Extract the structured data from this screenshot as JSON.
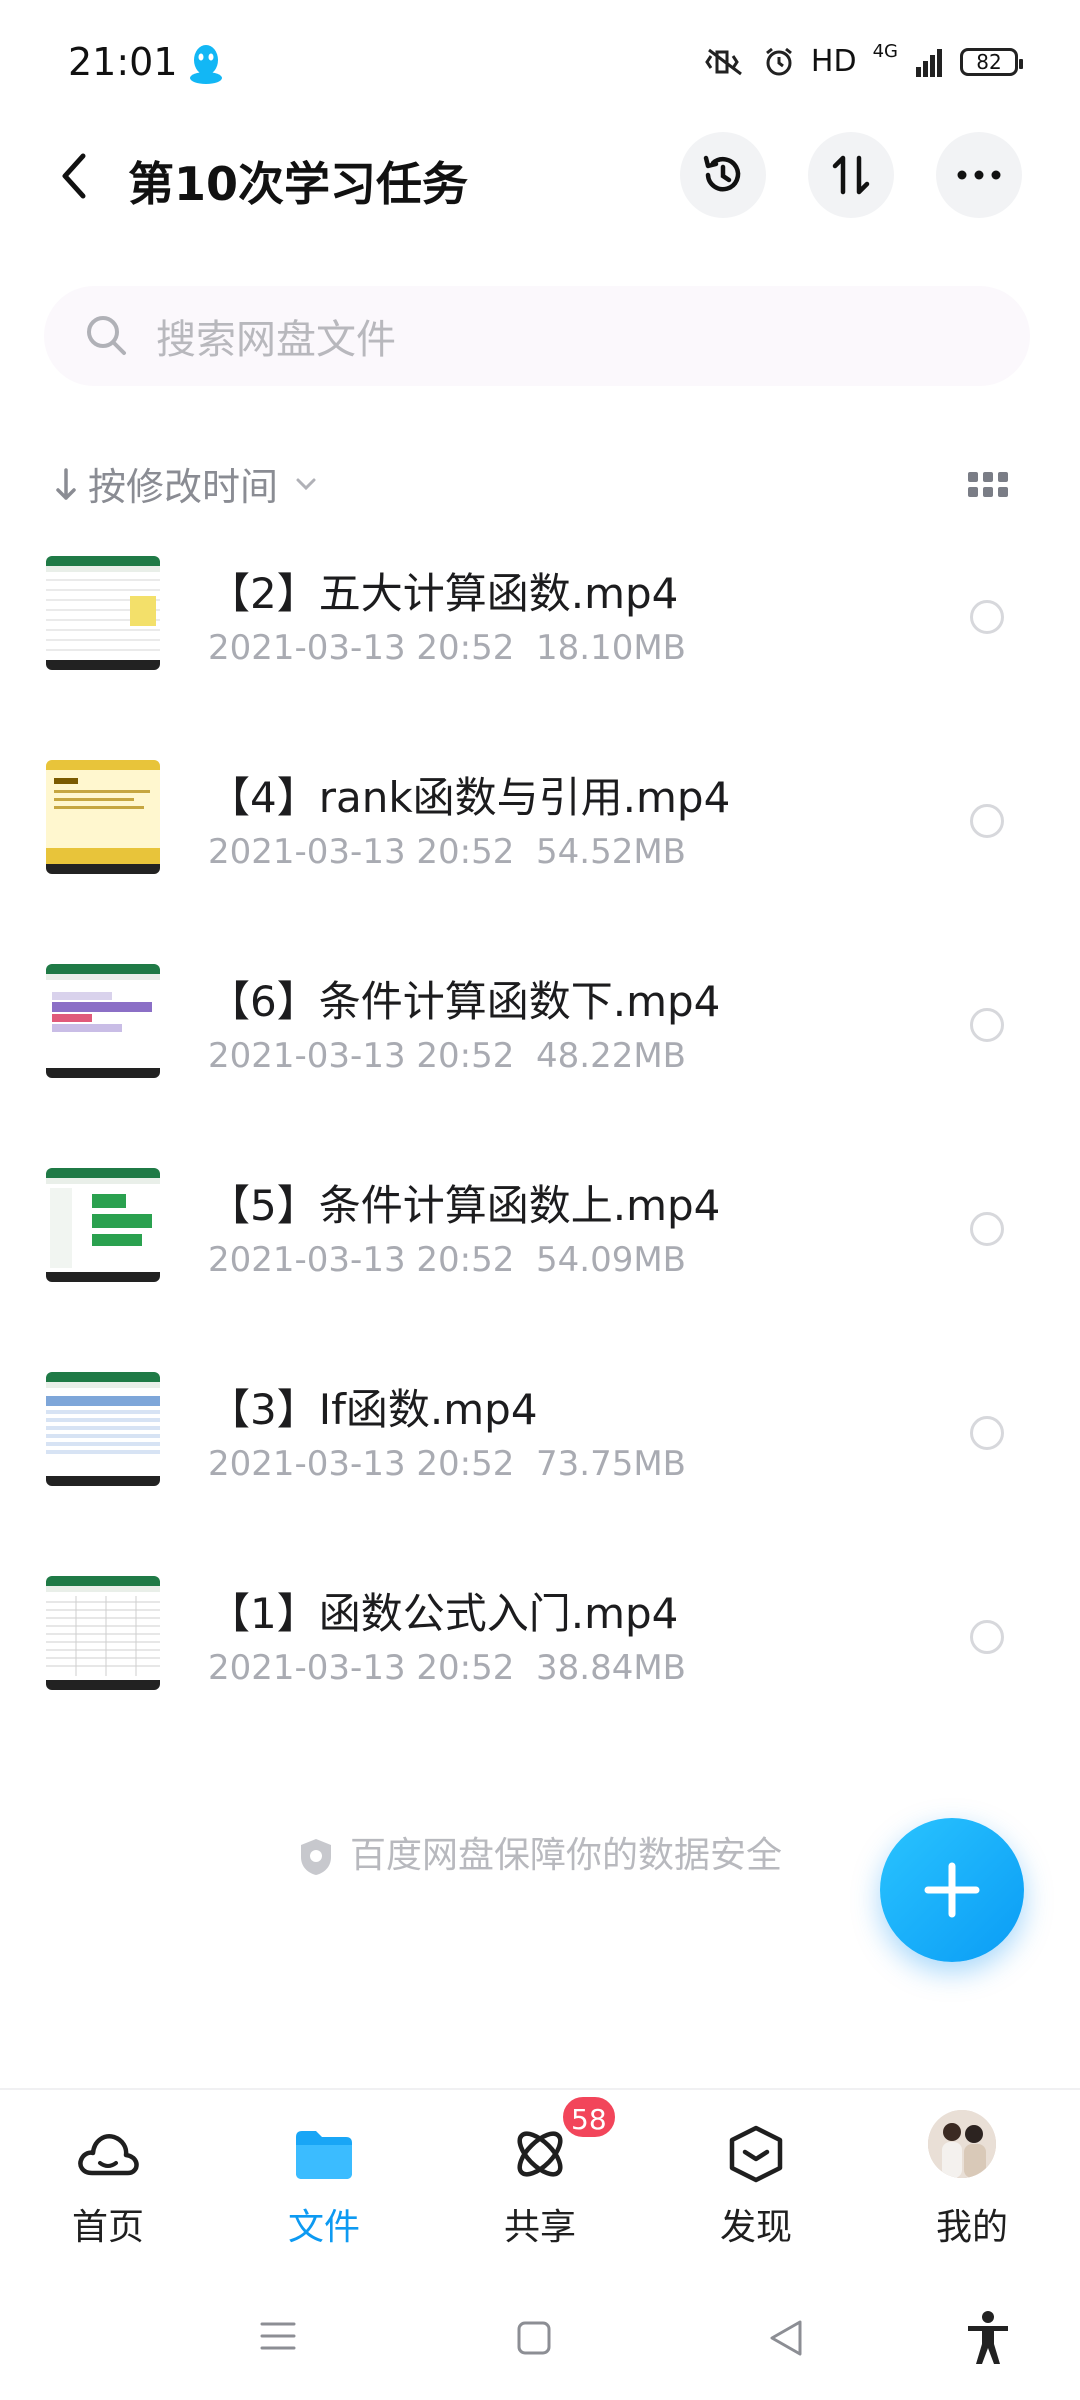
{
  "status_bar": {
    "time": "21:01",
    "network": "HD",
    "signal": "4G",
    "battery": "82"
  },
  "header": {
    "title": "第10次学习任务"
  },
  "search": {
    "placeholder": "搜索网盘文件"
  },
  "sort": {
    "label": "按修改时间"
  },
  "files": [
    {
      "name": "【2】五大计算函数.mp4",
      "date": "2021-03-13  20:52",
      "size": "18.10MB",
      "thumb": "excel-green"
    },
    {
      "name": "【4】rank函数与引用.mp4",
      "date": "2021-03-13  20:52",
      "size": "54.52MB",
      "thumb": "yellow-slide"
    },
    {
      "name": "【6】条件计算函数下.mp4",
      "date": "2021-03-13  20:52",
      "size": "48.22MB",
      "thumb": "excel-purple"
    },
    {
      "name": "【5】条件计算函数上.mp4",
      "date": "2021-03-13  20:52",
      "size": "54.09MB",
      "thumb": "excel-green"
    },
    {
      "name": "【3】If函数.mp4",
      "date": "2021-03-13  20:52",
      "size": "73.75MB",
      "thumb": "excel-blue"
    },
    {
      "name": "【1】函数公式入门.mp4",
      "date": "2021-03-13  20:52",
      "size": "38.84MB",
      "thumb": "excel-green"
    }
  ],
  "footer_note": "百度网盘保障你的数据安全",
  "tabs": [
    {
      "label": "首页",
      "icon": "cloud-icon",
      "active": false
    },
    {
      "label": "文件",
      "icon": "folder-icon",
      "active": true
    },
    {
      "label": "共享",
      "icon": "share-orbit-icon",
      "active": false,
      "badge": "58"
    },
    {
      "label": "发现",
      "icon": "discover-cube-icon",
      "active": false
    },
    {
      "label": "我的",
      "icon": "avatar",
      "active": false
    }
  ],
  "colors": {
    "accent": "#0d9af2",
    "badge": "#f2455a",
    "meta_text": "#a9abb2"
  }
}
